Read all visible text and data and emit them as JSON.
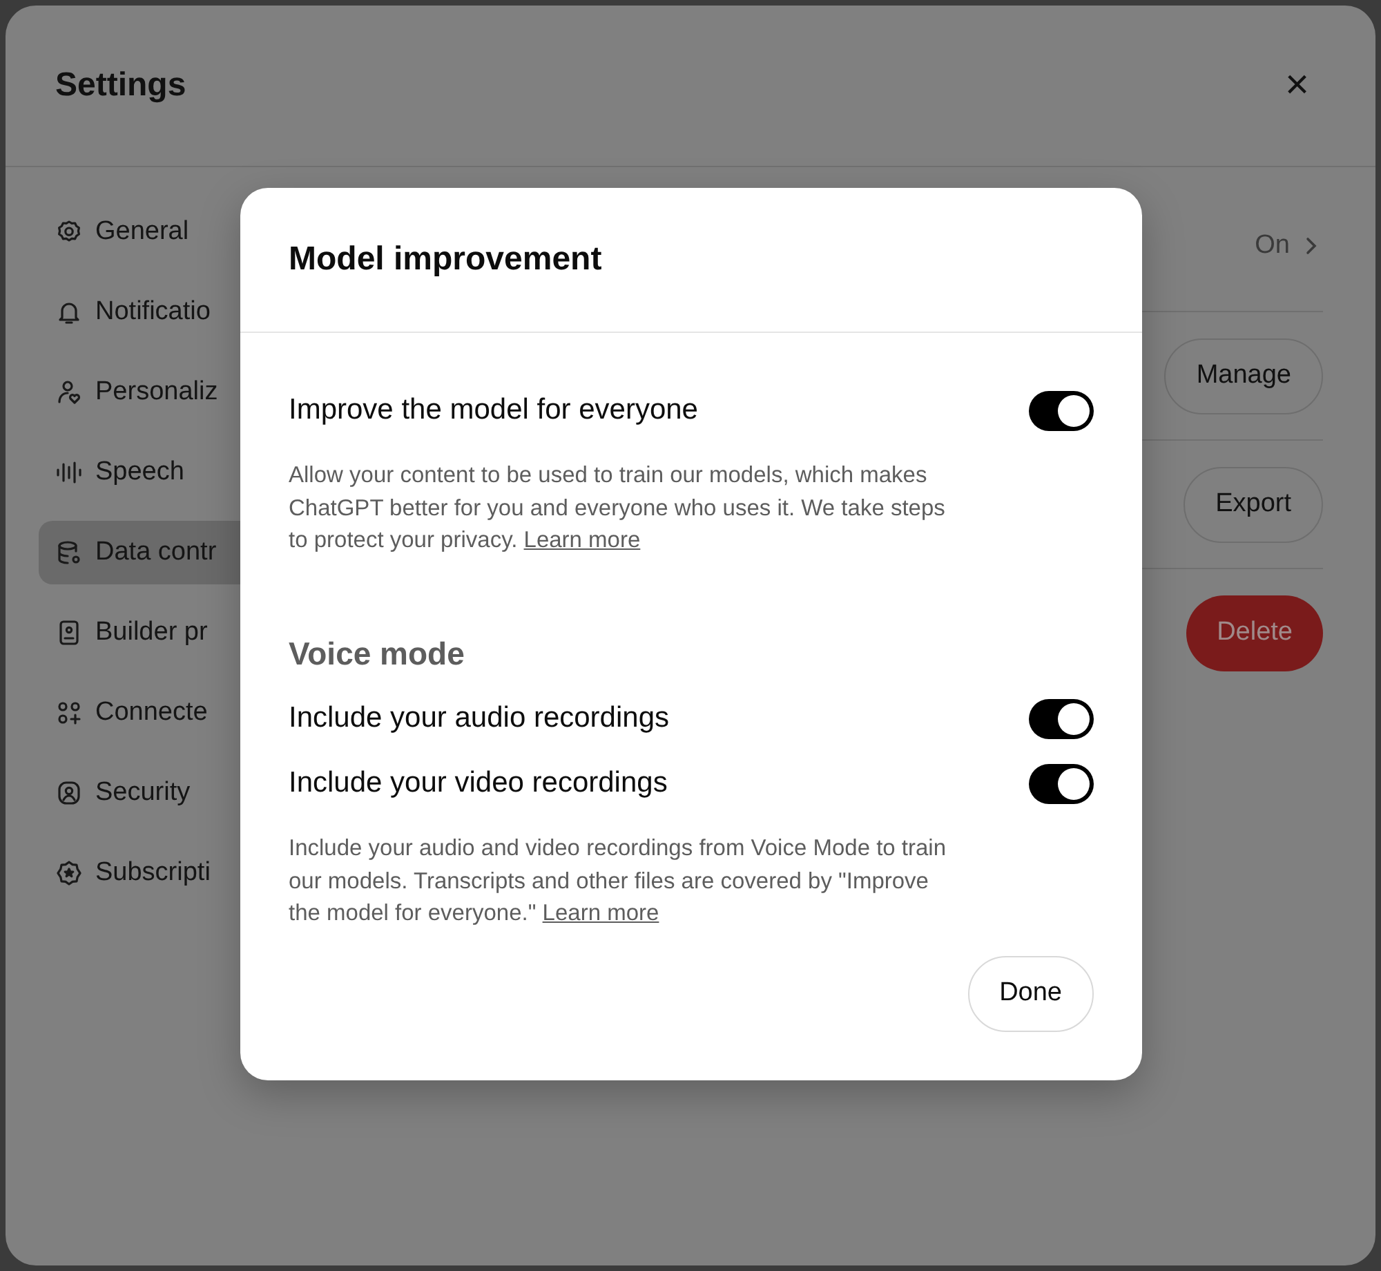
{
  "window": {
    "title": "Settings",
    "close": "×"
  },
  "sidebar": {
    "items": [
      {
        "label": "General",
        "selected": false
      },
      {
        "label": "Notificatio",
        "selected": false
      },
      {
        "label": "Personaliz",
        "selected": false
      },
      {
        "label": "Speech",
        "selected": false
      },
      {
        "label": "Data contr",
        "selected": true
      },
      {
        "label": "Builder pr",
        "selected": false
      },
      {
        "label": "Connecte",
        "selected": false
      },
      {
        "label": "Security",
        "selected": false
      },
      {
        "label": "Subscripti",
        "selected": false
      }
    ]
  },
  "content": {
    "rows": [
      {
        "kind": "value",
        "value": "On"
      },
      {
        "kind": "button",
        "label": "Manage"
      },
      {
        "kind": "button",
        "label": "Export"
      },
      {
        "kind": "danger",
        "label": "Delete"
      }
    ]
  },
  "dialog": {
    "title": "Model improvement",
    "sections": [
      {
        "toggles": [
          {
            "label": "Improve the model for everyone",
            "on": true
          }
        ],
        "description": "Allow your content to be used to train our models, which makes ChatGPT better for you and everyone who uses it. We take steps to protect your privacy.",
        "link": "Learn more"
      },
      {
        "heading": "Voice mode",
        "toggles": [
          {
            "label": "Include your audio recordings",
            "on": true
          },
          {
            "label": "Include your video recordings",
            "on": true
          }
        ],
        "description": "Include your audio and video recordings from Voice Mode to train our models. Transcripts and other files are covered by \"Improve the model for everyone.\"",
        "link": "Learn more"
      }
    ],
    "done_button": "Done"
  }
}
